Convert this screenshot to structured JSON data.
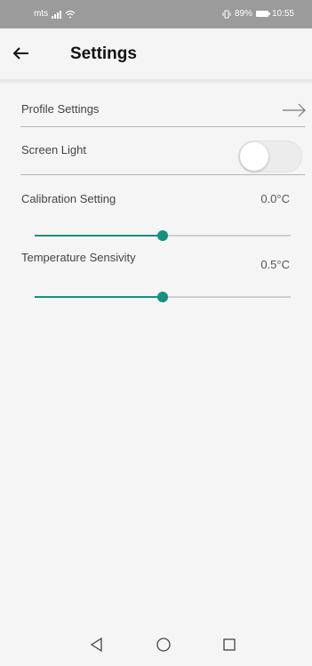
{
  "status_bar": {
    "carrier": "mts",
    "battery_text": "89%",
    "time": "10:55"
  },
  "app_bar": {
    "title": "Settings",
    "back_icon": "arrow-left-icon"
  },
  "settings": {
    "profile": {
      "label": "Profile Settings",
      "icon": "arrow-right-icon"
    },
    "screen_light": {
      "label": "Screen Light",
      "enabled": false
    },
    "calibration": {
      "label": "Calibration Setting",
      "value": "0.0°C",
      "slider_level": 0.5
    },
    "temperature": {
      "label": "Temperature Sensivity",
      "value": "0.5°C",
      "slider_level": 0.5
    }
  },
  "nav_bar": {
    "icons": [
      "back-triangle-icon",
      "home-circle-icon",
      "recents-square-icon"
    ]
  },
  "colors": {
    "accent": "#17907f",
    "status_bar": "#9b9b9b",
    "background": "#f5f5f5"
  }
}
